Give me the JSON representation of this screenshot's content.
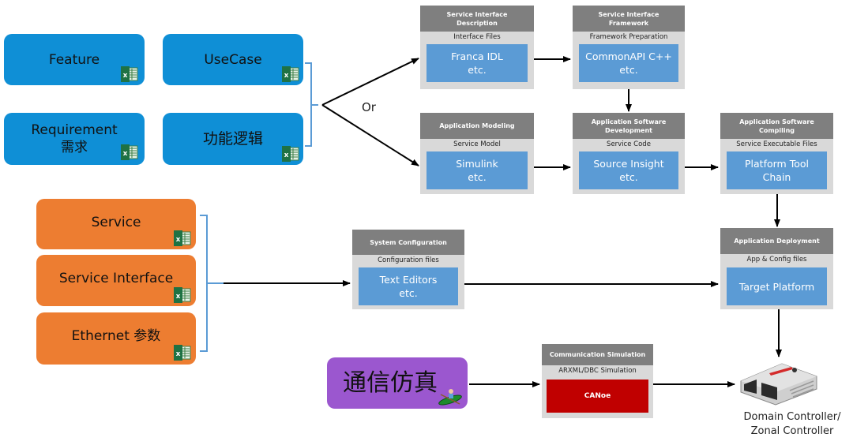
{
  "requirement_inputs": [
    {
      "id": "feature",
      "label_lines": [
        "Feature"
      ],
      "icon": "excel-icon"
    },
    {
      "id": "usecase",
      "label_lines": [
        "UseCase"
      ],
      "icon": "excel-icon"
    },
    {
      "id": "requirement",
      "label_lines": [
        "Requirement",
        "需求"
      ],
      "icon": "excel-icon"
    },
    {
      "id": "function-logic",
      "label_lines": [
        "功能逻辑"
      ],
      "icon": "excel-icon"
    }
  ],
  "branch_label": "Or",
  "service_inputs": [
    {
      "id": "service",
      "label": "Service",
      "icon": "excel-icon"
    },
    {
      "id": "service-interface",
      "label": "Service Interface",
      "icon": "excel-icon"
    },
    {
      "id": "ethernet-params",
      "label": "Ethernet 参数",
      "icon": "excel-icon"
    }
  ],
  "process_steps": {
    "service_interface_description": {
      "title_lines": [
        "Service Interface",
        "Description"
      ],
      "subtitle": "Interface Files",
      "tool_lines": [
        "Franca IDL",
        "etc."
      ]
    },
    "service_interface_framework": {
      "title_lines": [
        "Service Interface",
        "Framework"
      ],
      "subtitle": "Framework Preparation",
      "tool_lines": [
        "CommonAPI C++",
        "etc."
      ]
    },
    "application_modeling": {
      "title_lines": [
        "Application Modeling"
      ],
      "subtitle": "Service Model",
      "tool_lines": [
        "Simulink",
        "etc."
      ]
    },
    "application_software_development": {
      "title_lines": [
        "Application Software",
        "Development"
      ],
      "subtitle": "Service Code",
      "tool_lines": [
        "Source Insight",
        "etc."
      ]
    },
    "application_software_compiling": {
      "title_lines": [
        "Application Software",
        "Compiling"
      ],
      "subtitle": "Service Executable Files",
      "tool_lines": [
        "Platform Tool",
        "Chain"
      ]
    },
    "system_configuration": {
      "title_lines": [
        "System Configuration"
      ],
      "subtitle": "Configuration files",
      "tool_lines": [
        "Text Editors",
        "etc."
      ]
    },
    "application_deployment": {
      "title_lines": [
        "Application Deployment"
      ],
      "subtitle": "App & Config files",
      "tool_lines": [
        "Target Platform"
      ]
    },
    "communication_simulation": {
      "title_lines": [
        "Communication Simulation"
      ],
      "subtitle": "ARXML/DBC Simulation",
      "tool_lines": [
        "CANoe"
      ]
    }
  },
  "comm_sim_input": {
    "label": "通信仿真",
    "icon": "kayak-icon"
  },
  "target": {
    "label_lines": [
      "Domain Controller/",
      "Zonal Controller"
    ],
    "icon": "ecu-icon"
  },
  "colors": {
    "requirement_box": "#0f8fd6",
    "service_box": "#ed7d31",
    "comm_box": "#9b57cf",
    "step_header": "#7f7f7f",
    "step_body": "#d9d9d9",
    "tool_box": "#5b9bd5",
    "canoe_box": "#c00000",
    "bracket": "#5b9bd5",
    "arrow": "#000000"
  }
}
